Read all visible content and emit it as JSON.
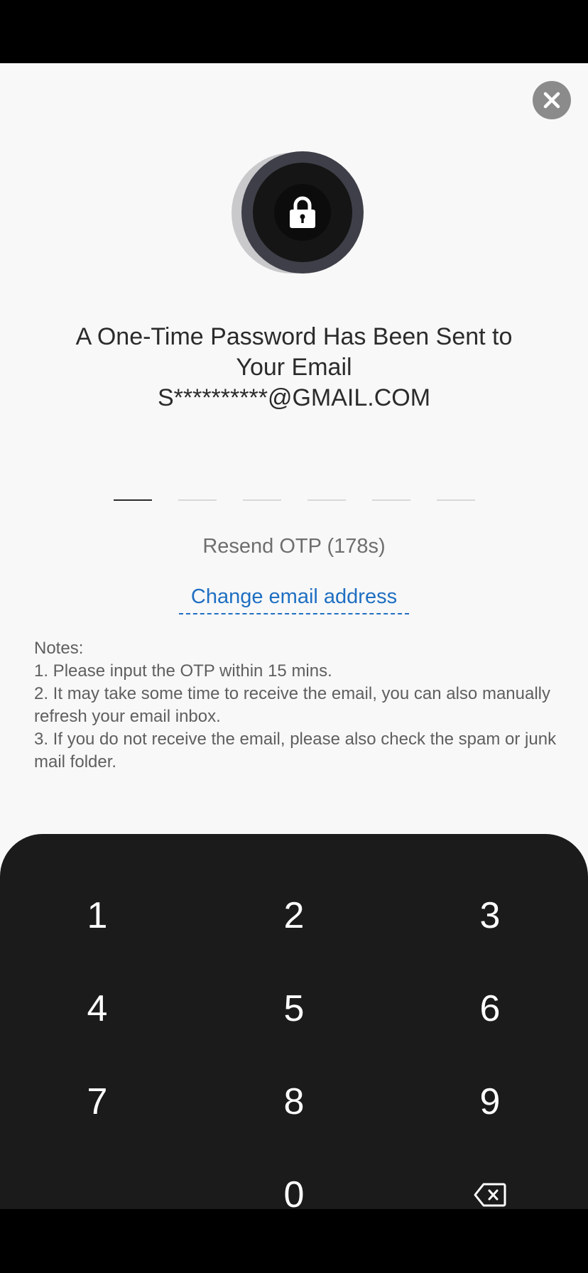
{
  "header": {
    "close_icon": "close-icon"
  },
  "lock": {
    "icon": "lock-icon"
  },
  "title": {
    "line1": "A One-Time Password Has Been Sent to",
    "line2": "Your Email",
    "line3": "S**********@GMAIL.COM"
  },
  "otp": {
    "length": 6,
    "active_index": 0
  },
  "resend": {
    "label": "Resend OTP (178s)"
  },
  "change_email": {
    "label": "Change email address"
  },
  "notes": {
    "heading": "Notes:",
    "items": [
      "1. Please input the OTP within 15 mins.",
      "2. It may take some time to receive the email, you can also manually refresh your email inbox.",
      "3. If you do not receive the email, please also check the spam or junk mail folder."
    ]
  },
  "keypad": {
    "keys": [
      "1",
      "2",
      "3",
      "4",
      "5",
      "6",
      "7",
      "8",
      "9",
      "",
      "0",
      "backspace"
    ],
    "backspace_icon": "backspace-icon"
  },
  "colors": {
    "accent": "#1f6fc2",
    "keypad_bg": "#1b1b1b",
    "sheet_bg": "#f8f8f8"
  }
}
